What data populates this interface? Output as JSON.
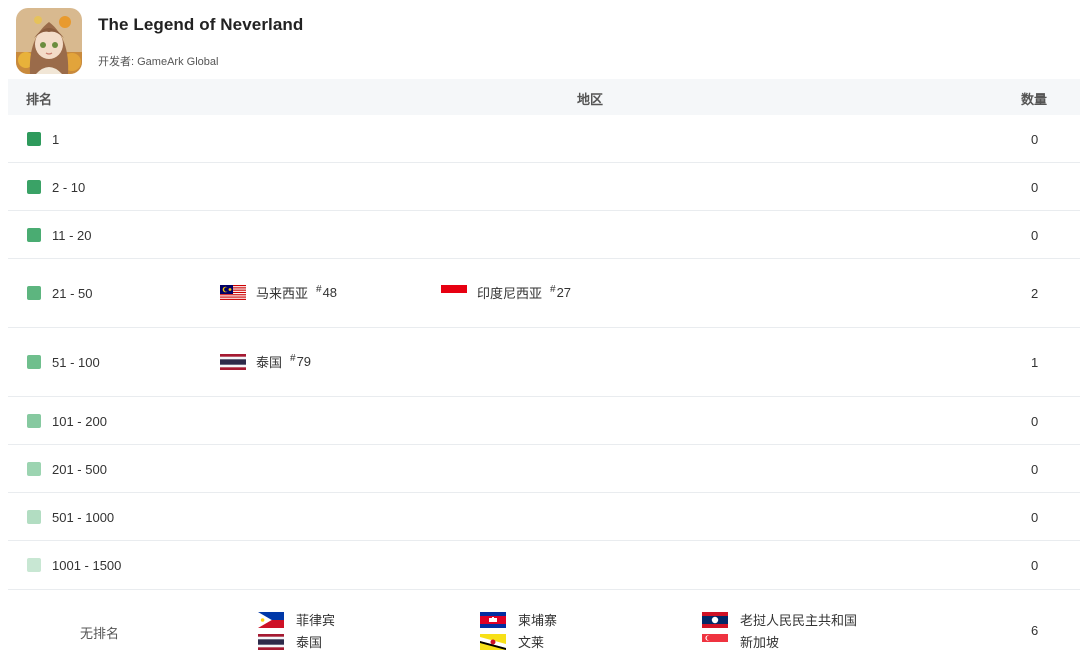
{
  "app": {
    "title": "The Legend of Neverland",
    "developer_label": "开发者:",
    "developer": "GameArk Global"
  },
  "table": {
    "headers": {
      "rank": "排名",
      "region": "地区",
      "count": "数量"
    },
    "rows": [
      {
        "rank": "1",
        "count": "0",
        "color": "#2e9a5c",
        "regions": []
      },
      {
        "rank": "2 - 10",
        "count": "0",
        "color": "#3aa266",
        "regions": []
      },
      {
        "rank": "11 - 20",
        "count": "0",
        "color": "#4aac72",
        "regions": []
      },
      {
        "rank": "21 - 50",
        "count": "2",
        "color": "#5db57f",
        "regions": [
          {
            "name": "马来西亚",
            "rank": "48",
            "flag": "malaysia-flag-icon"
          },
          {
            "name": "印度尼西亚",
            "rank": "27",
            "flag": "indonesia-flag-icon"
          }
        ]
      },
      {
        "rank": "51 - 100",
        "count": "1",
        "color": "#6fbf8d",
        "regions": [
          {
            "name": "泰国",
            "rank": "79",
            "flag": "thailand-flag-icon"
          }
        ]
      },
      {
        "rank": "101 - 200",
        "count": "0",
        "color": "#86c9a0",
        "regions": []
      },
      {
        "rank": "201 - 500",
        "count": "0",
        "color": "#9cd4b1",
        "regions": []
      },
      {
        "rank": "501 - 1000",
        "count": "0",
        "color": "#b2ddc2",
        "regions": []
      },
      {
        "rank": "1001 - 1500",
        "count": "0",
        "color": "#c8e7d3",
        "regions": []
      }
    ],
    "unranked": {
      "label": "无排名",
      "count": "6",
      "regions": [
        {
          "name": "菲律宾",
          "flag": "philippines-flag-icon"
        },
        {
          "name": "泰国",
          "flag": "thailand-flag-icon"
        },
        {
          "name": "柬埔寨",
          "flag": "cambodia-flag-icon"
        },
        {
          "name": "文莱",
          "flag": "brunei-flag-icon"
        },
        {
          "name": "老挝人民民主共和国",
          "flag": "laos-flag-icon"
        },
        {
          "name": "新加坡",
          "flag": "singapore-flag-icon"
        }
      ]
    }
  }
}
